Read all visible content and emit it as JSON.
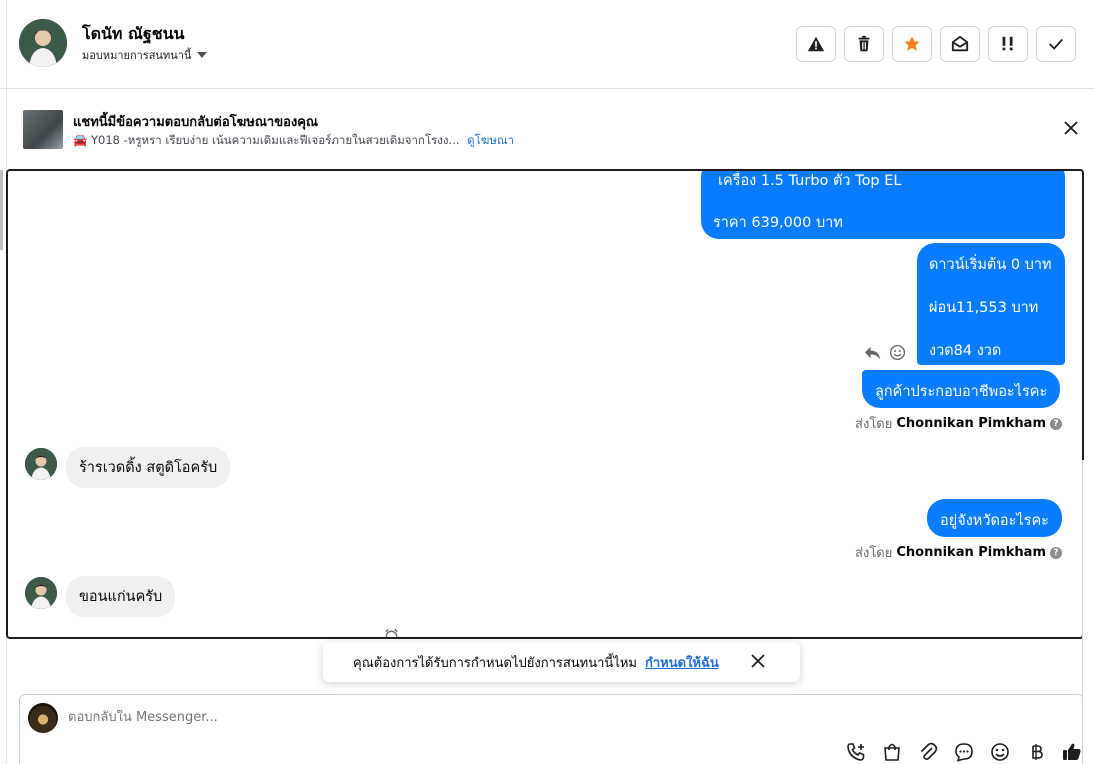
{
  "header": {
    "name": "โดนัท ณัฐชนน",
    "assign_label": "มอบหมายการสนทนานี้",
    "actions": [
      "report-icon",
      "trash-icon",
      "star-icon",
      "mark-unread-icon",
      "follow-up-icon",
      "done-icon"
    ],
    "star_color": "#f5821f"
  },
  "ad": {
    "title": "แชทนี้มีข้อความตอบกลับต่อโฆษณาของคุณ",
    "subtitle": "🚘 Y018 -หรูหรา เรียบง่าย เน้นความเดิมและฟีเจอร์ภายในสวยเดิมจากโรงง...",
    "link": "ดูโฆษณา"
  },
  "messages": {
    "out1_line1": "เครื่อง 1.5 Turbo ตัว Top EL",
    "out1_line2": "ราคา 639,000 บาท",
    "out2_line1": "ดาวน์เริ่มต้น 0 บาท",
    "out2_line2": "ผ่อน11,553 บาท",
    "out2_line3": "งวด84 งวด",
    "out3": "ลูกค้าประกอบอาชีพอะไรคะ",
    "sent_by_prefix": "ส่งโดย",
    "sent_by_name": "Chonnikan Pimkham",
    "in1": "ร้ารเวดดิ้ง สตูดิโอครับ",
    "out4": "อยู่จังหวัดอะไรคะ",
    "in2": "ขอนแก่นครับ"
  },
  "toast": {
    "text": "คุณต้องการได้รับการกำหนดไปยังการสนทนานี้ไหม",
    "link": "กำหนดให้ฉัน"
  },
  "composer": {
    "placeholder": "ตอบกลับใน Messenger..."
  },
  "colors": {
    "outgoing_bubble": "#0a7cff",
    "incoming_bubble": "#f0f0f0",
    "link": "#216fdb"
  }
}
